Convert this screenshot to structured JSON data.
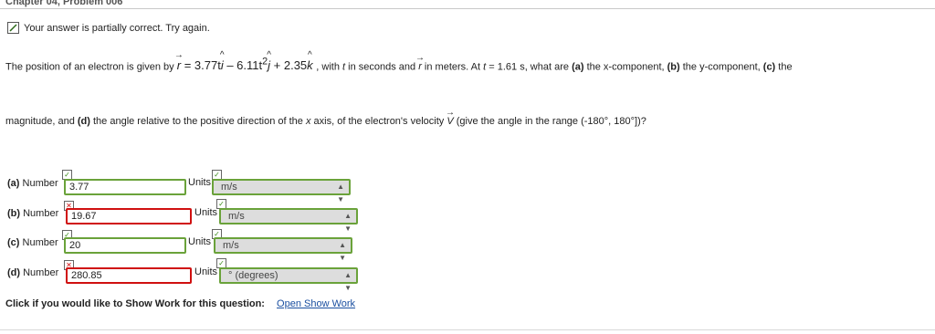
{
  "header": {
    "title": "Chapter 04, Problem 006"
  },
  "status": {
    "message": "Your answer is partially correct.  Try again."
  },
  "problem": {
    "intro": "The position of an electron is given by",
    "r_symbol": "r",
    "eq_part1": " = 3.77t",
    "i": "i",
    "eq_part2": " – 6.11t",
    "exp": "2",
    "j": "j",
    "eq_part3": " + 2.35",
    "k": "k",
    "after_eq": " , with ",
    "t": "t",
    "after_t": " in seconds and ",
    "r2": "r",
    "tail1": "  in meters. At ",
    "t2": "t",
    "tail2": " = 1.61 s, what are ",
    "a": "(a)",
    "a_text": " the x-component, ",
    "b": "(b)",
    "b_text": " the y-component, ",
    "c": "(c)",
    "c_text": " the",
    "line2a": "magnitude, and ",
    "d": "(d)",
    "line2b": " the angle relative to the positive direction of the ",
    "x": "x",
    "line2c": " axis, of the electron's velocity ",
    "v": "V",
    "line2d": "  (give the angle in the range (-180°, 180°])?"
  },
  "answers": [
    {
      "part": "(a)",
      "label": "Number",
      "value": "3.77",
      "number_status": "correct",
      "units_label": "Units",
      "unit": "m/s",
      "unit_status": "correct"
    },
    {
      "part": "(b)",
      "label": "Number",
      "value": "19.67",
      "number_status": "incorrect",
      "units_label": "Units",
      "unit": "m/s",
      "unit_status": "correct"
    },
    {
      "part": "(c)",
      "label": "Number",
      "value": "20",
      "number_status": "correct",
      "units_label": "Units",
      "unit": "m/s",
      "unit_status": "correct"
    },
    {
      "part": "(d)",
      "label": "Number",
      "value": "280.85",
      "number_status": "incorrect",
      "units_label": "Units",
      "unit": "° (degrees)",
      "unit_status": "correct"
    }
  ],
  "show_work": {
    "prompt": "Click if you would like to Show Work for this question:",
    "link": "Open Show Work"
  },
  "colors": {
    "correct": "#6aa23a",
    "incorrect": "#d01010",
    "link": "#1a4fa0"
  },
  "icons": {
    "status": "pencil-check-icon",
    "correct_mark": "check-icon",
    "incorrect_mark": "x-icon",
    "select_caret": "chevron-updown-icon"
  }
}
